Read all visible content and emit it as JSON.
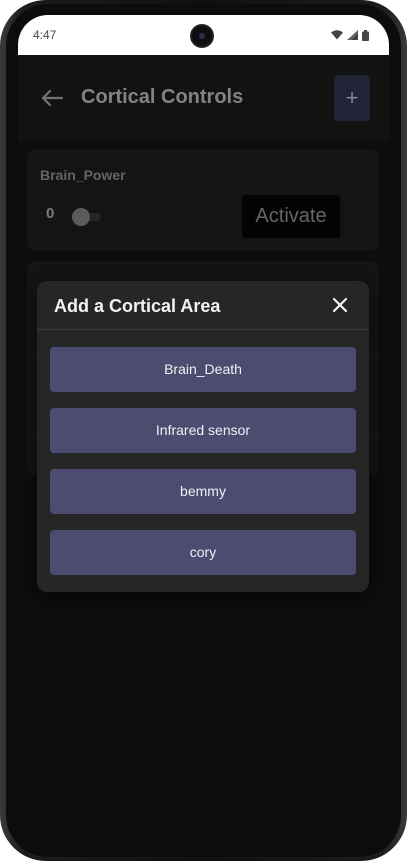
{
  "status_bar": {
    "time": "4:47",
    "icons": [
      "wifi-icon",
      "signal-icon",
      "battery-icon"
    ]
  },
  "header": {
    "title": "Cortical Controls",
    "back_icon": "arrow-left-icon",
    "add_label": "+"
  },
  "cards": [
    {
      "label": "Brain_Power",
      "slider_value": "0",
      "activate_label": "Activate"
    }
  ],
  "modal": {
    "title": "Add a Cortical Area",
    "close_icon": "close-icon",
    "options": [
      "Brain_Death",
      "Infrared sensor",
      "bemmy",
      "cory"
    ]
  },
  "colors": {
    "accent": "#4b4c70",
    "add_button": "#333653",
    "background": "#151515"
  }
}
